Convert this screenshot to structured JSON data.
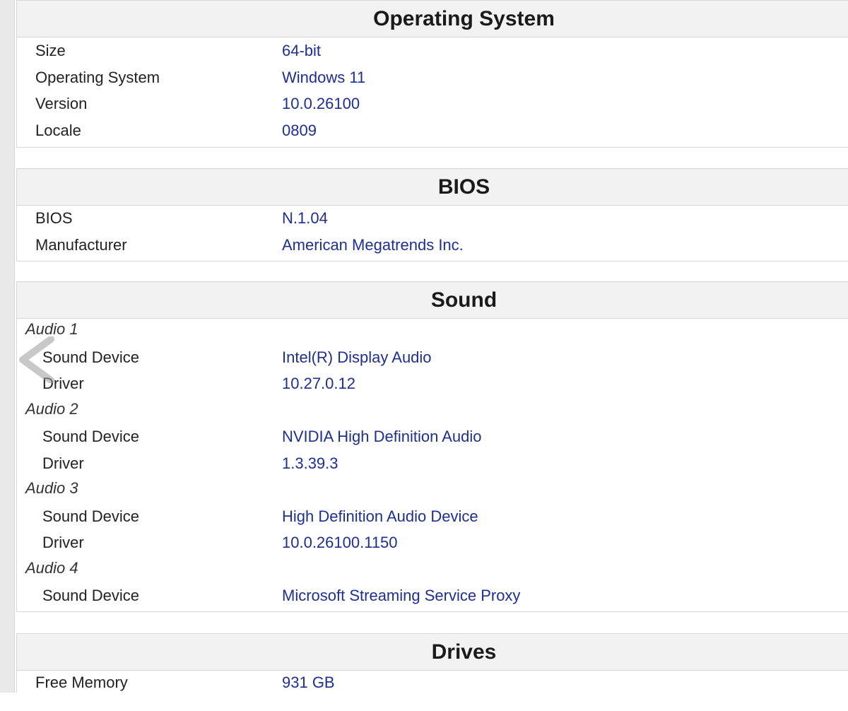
{
  "sections": {
    "os": {
      "title": "Operating System",
      "rows": [
        {
          "label": "Size",
          "value": "64-bit"
        },
        {
          "label": "Operating System",
          "value": "Windows 11"
        },
        {
          "label": "Version",
          "value": "10.0.26100"
        },
        {
          "label": "Locale",
          "value": "0809"
        }
      ]
    },
    "bios": {
      "title": "BIOS",
      "rows": [
        {
          "label": "BIOS",
          "value": "N.1.04"
        },
        {
          "label": "Manufacturer",
          "value": "American Megatrends Inc."
        }
      ]
    },
    "sound": {
      "title": "Sound",
      "groups": [
        {
          "name": "Audio 1",
          "device_label": "Sound Device",
          "device": "Intel(R) Display Audio",
          "driver_label": "Driver",
          "driver": "10.27.0.12"
        },
        {
          "name": "Audio 2",
          "device_label": "Sound Device",
          "device": "NVIDIA High Definition Audio",
          "driver_label": "Driver",
          "driver": "1.3.39.3"
        },
        {
          "name": "Audio 3",
          "device_label": "Sound Device",
          "device": "High Definition Audio Device",
          "driver_label": "Driver",
          "driver": "10.0.26100.1150"
        },
        {
          "name": "Audio 4",
          "device_label": "Sound Device",
          "device": "Microsoft Streaming Service Proxy"
        }
      ]
    },
    "drives": {
      "title": "Drives",
      "rows": [
        {
          "label": "Free Memory",
          "value": "931 GB"
        }
      ]
    }
  },
  "icons": {
    "back": "chevron-left-icon"
  },
  "colors": {
    "value_text": "#1c2e9a",
    "header_bg": "#f2f2f2",
    "border": "#d6d6d6"
  }
}
